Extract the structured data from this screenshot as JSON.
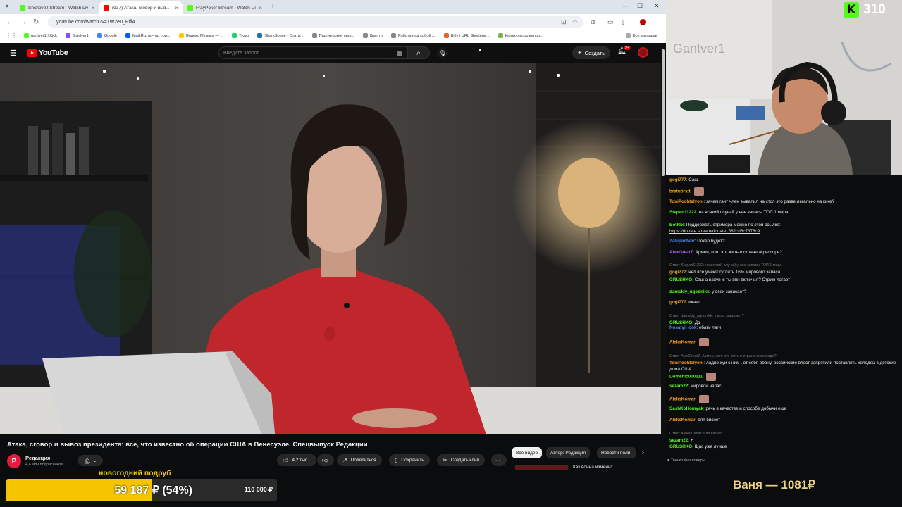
{
  "browser": {
    "tabs": [
      {
        "title": "Shshovez Stream - Watch Live",
        "favicon": "kick-icon",
        "active": false
      },
      {
        "title": "(937) Атака, сговор и выв...",
        "favicon": "youtube-icon",
        "active": true
      },
      {
        "title": "FrayPoker Stream - Watch Live",
        "favicon": "kick-icon",
        "active": false
      }
    ],
    "url": "youtube.com/watch?v=1W2e0_Pifl4",
    "bookmarks": [
      {
        "label": "gantver1 | Kick",
        "color": "#53fc18"
      },
      {
        "label": "Gantver1",
        "color": "#9146ff"
      },
      {
        "label": "Google",
        "color": "#4285f4"
      },
      {
        "label": "Mail.Ru: почта, пои...",
        "color": "#005ff9"
      },
      {
        "label": "Яндекс Музыка — ...",
        "color": "#ffcc00"
      },
      {
        "label": "Trovo",
        "color": "#19d66b"
      },
      {
        "label": "SharkScope - Стати...",
        "color": "#1f6fb2"
      },
      {
        "label": "Партнерские прог...",
        "color": "#888888"
      },
      {
        "label": "Крипто",
        "color": "#888888"
      },
      {
        "label": "Работа над собой ...",
        "color": "#888888"
      },
      {
        "label": "Bitly | URL Shortene...",
        "color": "#ee6123"
      },
      {
        "label": "Калькулятор калор...",
        "color": "#7cb342"
      }
    ],
    "all_bookmarks": "Все закладки"
  },
  "youtube": {
    "logo_text": "YouTube",
    "search_placeholder": "Введите запрос",
    "create_label": "Создать",
    "notif_badge": "9+",
    "video_title": "Атака, сговор и вывоз президента: все, что известно об операции США в Венесуэле. Спецвыпуск Редакции",
    "channel_name": "Редакция",
    "channel_subs": "4,4 млн подписчиков",
    "likes": "4,2 тыс.",
    "share_label": "Поделиться",
    "save_label": "Сохранить",
    "clip_label": "Создать клип",
    "chips": [
      "Все видео",
      "Автор: Редакция",
      "Новости поли"
    ],
    "next_video": "Как война изменит..."
  },
  "stream": {
    "viewers": "310",
    "chat_messages": [
      {
        "user": "gogi777",
        "color": "#e59b2f",
        "text": "Саш"
      },
      {
        "user": "bratubratt",
        "color": "#ff9f1c",
        "text": ""
      },
      {
        "user": "ToniPochtalyoni",
        "color": "#ff9f1c",
        "text": "зачем гант член вывалил на стол это разве легально на кике?"
      },
      {
        "user": "Stepan11222",
        "color": "#53fc18",
        "text": "на всякий случай у нее запасы ТОП 1 мира"
      },
      {
        "user": "BotRix",
        "color": "#53fc18",
        "text": "Поддержать стримера можно по этой ссылке:",
        "link": "https://donate.stream/donate_682cd6c7376c9"
      },
      {
        "user": "Zalupantver",
        "color": "#4f8cff",
        "text": "Покер будет?"
      },
      {
        "user": "AlexGreat7",
        "color": "#b362ff",
        "text": "Армен, кого это жить в стране агрессоре?"
      },
      {
        "user": "gogi777",
        "color": "#e59b2f",
        "reply": "Ответ Stepan11222: на всякий случай у нее запасы ТОП 1 мира",
        "text": "чел все умеют гуглить 16% мирового запаса"
      },
      {
        "user": "GRUSHKO",
        "color": "#53fc18",
        "text": "Саш а нахуя ж ты впн включил? Стрим лагает"
      },
      {
        "user": "damskiy_ugodnikk",
        "color": "#53fc18",
        "text": "у всех зависает?"
      },
      {
        "user": "gogi777",
        "color": "#e59b2f",
        "text": "икает"
      },
      {
        "user": "GRUSHKO",
        "color": "#53fc18",
        "reply": "Ответ damskiy_ugodnikk: у всех зависает?",
        "text": "Да"
      },
      {
        "user": "NosatyiHook",
        "color": "#4f8cff",
        "text": "ебать лаги"
      },
      {
        "user": "AleksKomar",
        "color": "#ff9f1c",
        "text": ""
      },
      {
        "user": "ToniPochtalyoni",
        "color": "#ff9f1c",
        "reply": "Ответ AlexGreat7: Армен, кого это жить в стране агрессоре?",
        "text": "ладно хуй с ним . от себя ебану. российские власт запретили поставлять холодец в детские дома США"
      },
      {
        "user": "Domenic000111",
        "color": "#53fc18",
        "text": ""
      },
      {
        "user": "sezam22",
        "color": "#53fc18",
        "text": "мировой напас"
      },
      {
        "user": "AleksKomar",
        "color": "#ff9f1c",
        "text": ""
      },
      {
        "user": "SashKoHomyak",
        "color": "#53fc18",
        "text": "речь в качестве и способе добычи еще"
      },
      {
        "user": "AleksKomar",
        "color": "#ff9f1c",
        "text": "бля виснет"
      },
      {
        "user": "sezam22",
        "color": "#53fc18",
        "reply": "Ответ AleksKomar: бля виснет",
        "text": "+"
      },
      {
        "user": "GRUSHKO",
        "color": "#53fc18",
        "text": "Щас уже лучше"
      }
    ],
    "followers_only": "Только фолловеры",
    "goal_title": "новогодний подруб",
    "goal_amount": "59 187 ₽ (54%)",
    "goal_target": "110 000 ₽",
    "goal_progress": 0.54,
    "top_donor": "Ваня — 1081₽"
  }
}
